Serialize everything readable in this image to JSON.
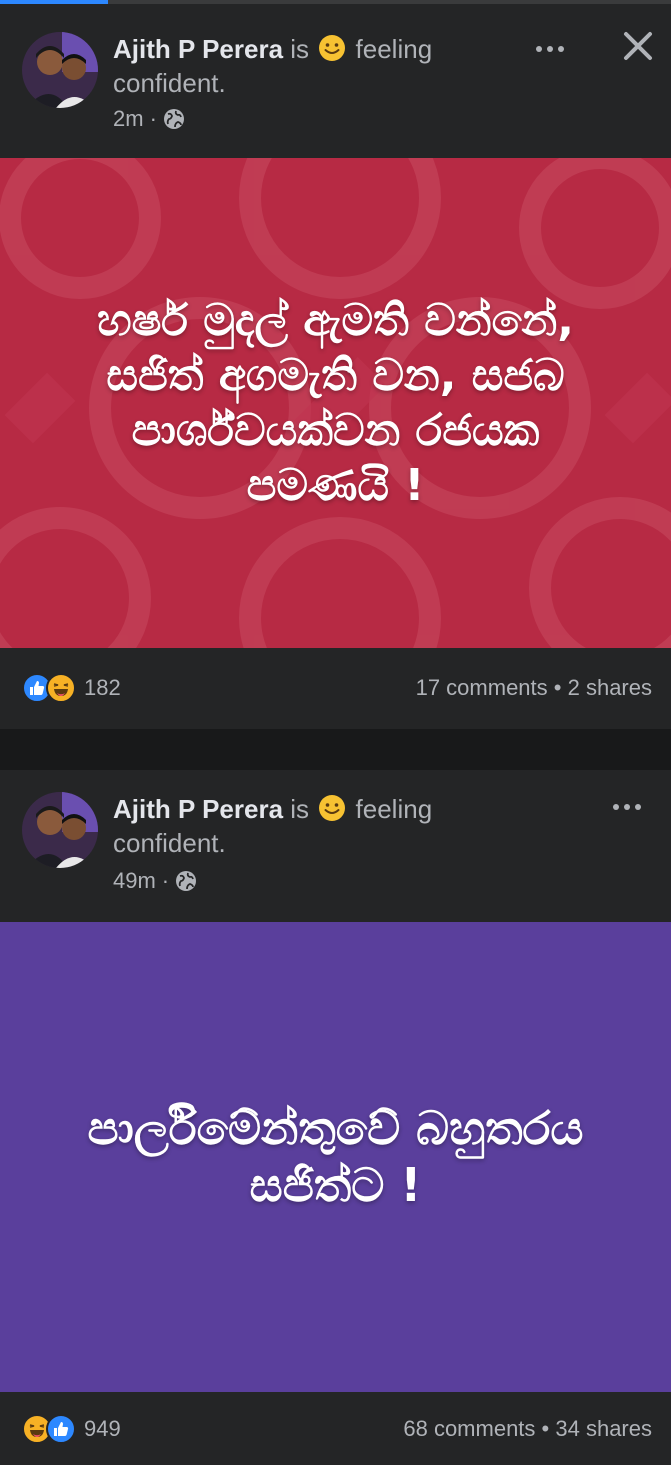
{
  "posts": [
    {
      "author": "Ajith P Perera",
      "status_is": "is",
      "feeling": "feeling",
      "feeling_value": "confident.",
      "time": "2m",
      "separator": "·",
      "card_text": "හර්ෂ මුදල් ඇමති වන්නේ, සජිත් අගමැති වන, සජබ පාර්ශ්වයක්වන රජයක පමණයි !",
      "card_color": "#b72a44",
      "reaction_count": "182",
      "comments": "17 comments",
      "stats_sep": "•",
      "shares": "2 shares"
    },
    {
      "author": "Ajith P Perera",
      "status_is": "is",
      "feeling": "feeling",
      "feeling_value": "confident.",
      "time": "49m",
      "separator": "·",
      "card_text": "පාර්ලිමේන්තුවේ බහුතරය සජිත්ට !",
      "card_color": "#5a3f9c",
      "reaction_count": "949",
      "comments": "68 comments",
      "stats_sep": "•",
      "shares": "34 shares"
    }
  ],
  "colors": {
    "like": "#2d88ff",
    "haha": "#f7b125",
    "background": "#18191a",
    "post_bg": "#242526"
  },
  "icons": [
    "globe-icon",
    "smile-emoji-icon",
    "more-icon",
    "close-icon",
    "like-reaction-icon",
    "haha-reaction-icon"
  ]
}
